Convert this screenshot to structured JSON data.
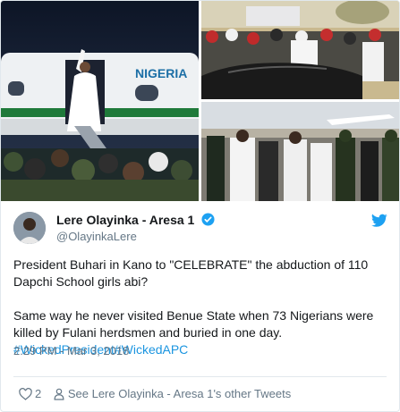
{
  "photos": {
    "plane_livery": "NIGERIA"
  },
  "tweet": {
    "display_name": "Lere Olayinka - Aresa 1",
    "handle": "@OlayinkaLere",
    "paragraph_1": "President Buhari in Kano to \"CELEBRATE\" the abduction of 110 Dapchi School girls abi?",
    "paragraph_2": "Same way he never visited Benue State when 73 Nigerians were killed by Fulani herdsmen and buried in one day.",
    "hashtags": [
      "#WickedPresident",
      "#WickedAPC"
    ],
    "timestamp": "2:29 PM - Mar 3, 2018",
    "like_count": "2",
    "other_tweets_link": "See Lere Olayinka - Aresa 1's other Tweets"
  },
  "icons": [
    "verified-badge-icon",
    "twitter-bird-icon",
    "heart-icon",
    "person-icon"
  ],
  "colors": {
    "link": "#1b95e0",
    "verified": "#1da1f2",
    "secondary_text": "#657786",
    "primary_text": "#14171a"
  }
}
